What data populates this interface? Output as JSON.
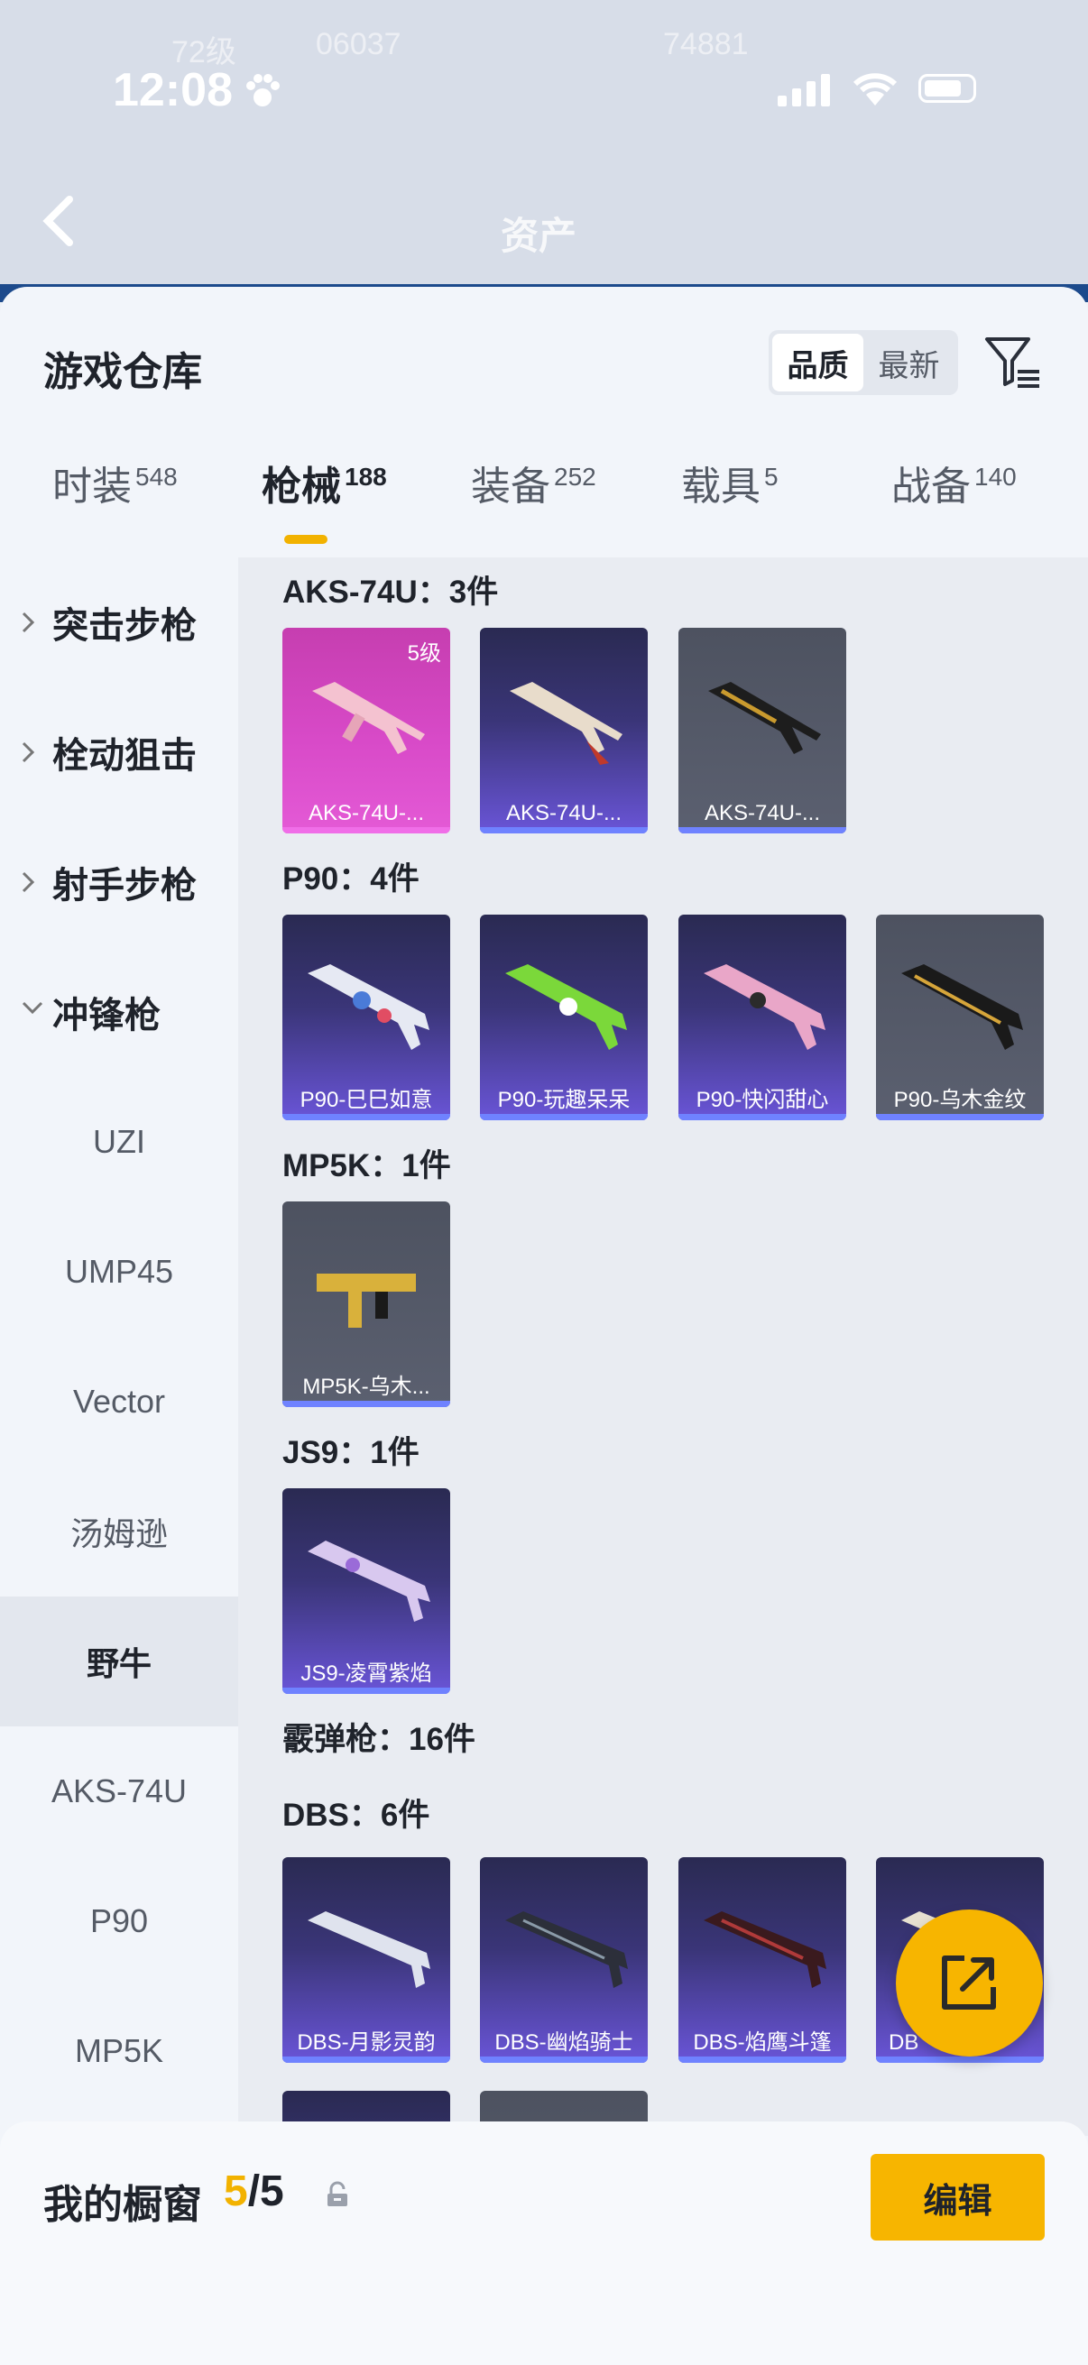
{
  "status_bar": {
    "time": "12:08"
  },
  "background_header": {
    "title": "资产",
    "ghost_level": "72级",
    "ghost_score1": "06037",
    "ghost_score2": "74881"
  },
  "sheet": {
    "title": "游戏仓库",
    "sort_options": [
      "品质",
      "最新"
    ],
    "tabs": [
      {
        "label": "时装",
        "count": "548"
      },
      {
        "label": "枪械",
        "count": "188"
      },
      {
        "label": "装备",
        "count": "252"
      },
      {
        "label": "载具",
        "count": "5"
      },
      {
        "label": "战备",
        "count": "140"
      }
    ],
    "categories": [
      {
        "label": "突击步枪",
        "type": "group"
      },
      {
        "label": "栓动狙击",
        "type": "group"
      },
      {
        "label": "射手步枪",
        "type": "group"
      },
      {
        "label": "冲锋枪",
        "type": "group"
      },
      {
        "label": "UZI",
        "type": "sub"
      },
      {
        "label": "UMP45",
        "type": "sub"
      },
      {
        "label": "Vector",
        "type": "sub"
      },
      {
        "label": "汤姆逊",
        "type": "sub"
      },
      {
        "label": "野牛",
        "type": "sub"
      },
      {
        "label": "AKS-74U",
        "type": "sub"
      },
      {
        "label": "P90",
        "type": "sub"
      },
      {
        "label": "MP5K",
        "type": "sub"
      }
    ],
    "sections": [
      {
        "title": "AKS-74U：3件",
        "items": [
          {
            "label": "AKS-74U-...",
            "level": "5级"
          },
          {
            "label": "AKS-74U-..."
          },
          {
            "label": "AKS-74U-..."
          }
        ]
      },
      {
        "title": "P90：4件",
        "items": [
          {
            "label": "P90-巳巳如意"
          },
          {
            "label": "P90-玩趣呆呆"
          },
          {
            "label": "P90-快闪甜心"
          },
          {
            "label": "P90-乌木金纹"
          }
        ]
      },
      {
        "title": "MP5K：1件",
        "items": [
          {
            "label": "MP5K-乌木..."
          }
        ]
      },
      {
        "title": "JS9：1件",
        "items": [
          {
            "label": "JS9-凌霄紫焰"
          }
        ]
      },
      {
        "title": "霰弹枪：16件"
      },
      {
        "title": "DBS：6件",
        "items": [
          {
            "label": "DBS-月影灵韵"
          },
          {
            "label": "DBS-幽焰骑士"
          },
          {
            "label": "DBS-焰鹰斗篷"
          },
          {
            "label": "DB"
          }
        ]
      }
    ]
  },
  "bottom_panel": {
    "title": "我的橱窗",
    "count_current": "5",
    "count_sep_total": "/5",
    "edit_label": "编辑"
  }
}
